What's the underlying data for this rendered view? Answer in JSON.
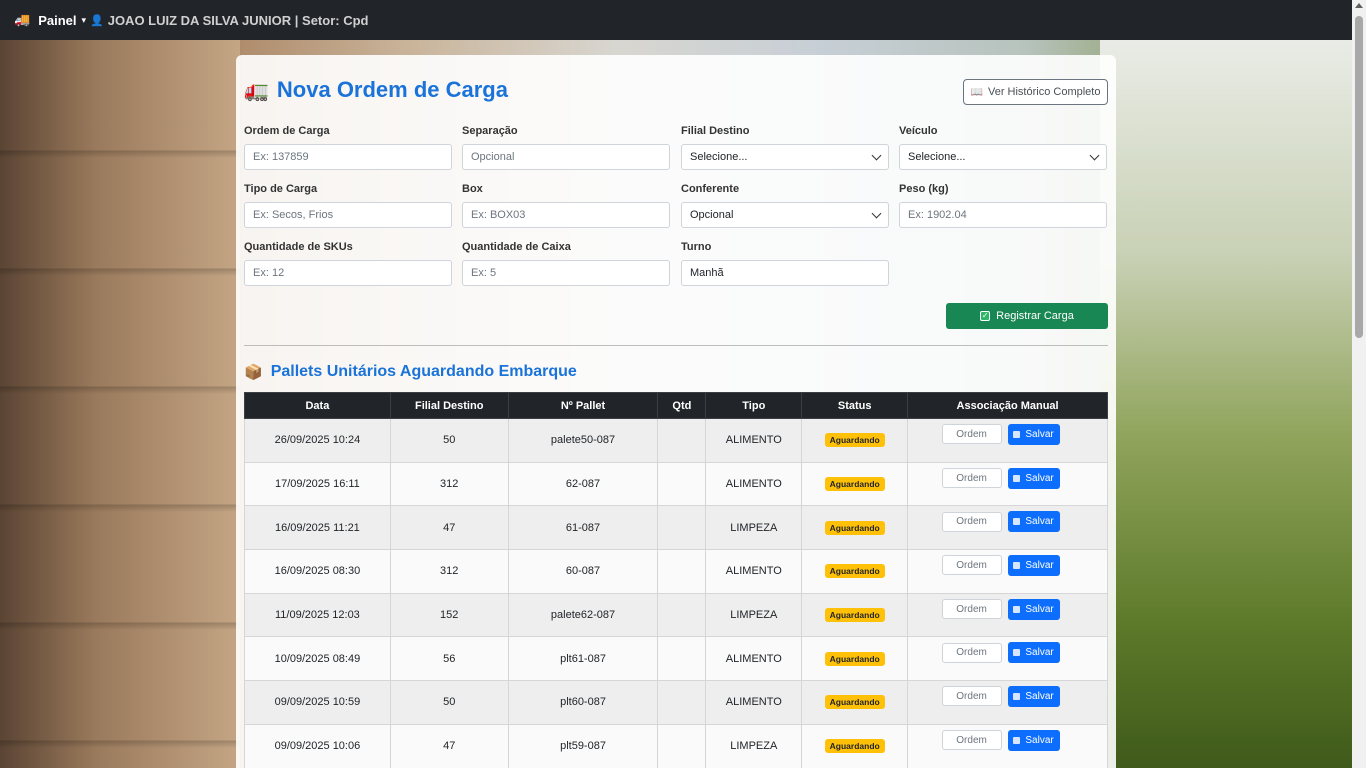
{
  "navbar": {
    "brand_icon": "truck-icon",
    "brand": "Painel",
    "caret": "▾",
    "user_icon": "user-icon",
    "user": "JOAO LUIZ DA SILVA JUNIOR | Setor: Cpd"
  },
  "card": {
    "title_icon": "🚛",
    "title": "Nova Ordem de Carga",
    "history_button": "Ver Histórico Completo",
    "register_button": "Registrar Carga"
  },
  "form": {
    "ordem_label": "Ordem de Carga",
    "ordem_placeholder": "Ex: 137859",
    "separacao_label": "Separação",
    "separacao_placeholder": "Opcional",
    "filial_label": "Filial Destino",
    "filial_value": "Selecione...",
    "veiculo_label": "Veículo",
    "veiculo_value": "Selecione...",
    "tipo_label": "Tipo de Carga",
    "tipo_placeholder": "Ex: Secos, Frios",
    "box_label": "Box",
    "box_placeholder": "Ex: BOX03",
    "conferente_label": "Conferente",
    "conferente_value": "Opcional",
    "peso_label": "Peso (kg)",
    "peso_placeholder": "Ex: 1902.04",
    "skus_label": "Quantidade de SKUs",
    "skus_placeholder": "Ex: 12",
    "caixa_label": "Quantidade de Caixa",
    "caixa_placeholder": "Ex: 5",
    "turno_label": "Turno",
    "turno_value": "Manhã"
  },
  "pallets": {
    "icon": "📦",
    "title": "Pallets Unitários Aguardando Embarque",
    "columns": [
      "Data",
      "Filial Destino",
      "Nº Pallet",
      "Qtd",
      "Tipo",
      "Status",
      "Associação Manual"
    ],
    "order_placeholder": "Ordem",
    "save_label": "Salvar",
    "rows": [
      {
        "data": "26/09/2025 10:24",
        "filial": "50",
        "pallet": "palete50-087",
        "qtd": "",
        "tipo": "ALIMENTO",
        "status": "Aguardando"
      },
      {
        "data": "17/09/2025 16:11",
        "filial": "312",
        "pallet": "62-087",
        "qtd": "",
        "tipo": "ALIMENTO",
        "status": "Aguardando"
      },
      {
        "data": "16/09/2025 11:21",
        "filial": "47",
        "pallet": "61-087",
        "qtd": "",
        "tipo": "LIMPEZA",
        "status": "Aguardando"
      },
      {
        "data": "16/09/2025 08:30",
        "filial": "312",
        "pallet": "60-087",
        "qtd": "",
        "tipo": "ALIMENTO",
        "status": "Aguardando"
      },
      {
        "data": "11/09/2025 12:03",
        "filial": "152",
        "pallet": "palete62-087",
        "qtd": "",
        "tipo": "LIMPEZA",
        "status": "Aguardando"
      },
      {
        "data": "10/09/2025 08:49",
        "filial": "56",
        "pallet": "plt61-087",
        "qtd": "",
        "tipo": "ALIMENTO",
        "status": "Aguardando"
      },
      {
        "data": "09/09/2025 10:59",
        "filial": "50",
        "pallet": "plt60-087",
        "qtd": "",
        "tipo": "ALIMENTO",
        "status": "Aguardando"
      },
      {
        "data": "09/09/2025 10:06",
        "filial": "47",
        "pallet": "plt59-087",
        "qtd": "",
        "tipo": "LIMPEZA",
        "status": "Aguardando"
      }
    ]
  },
  "colors": {
    "accent": "#1a73d9",
    "success": "#198754",
    "primary": "#0d6efd",
    "warning": "#ffc107",
    "navbar": "#212529"
  }
}
